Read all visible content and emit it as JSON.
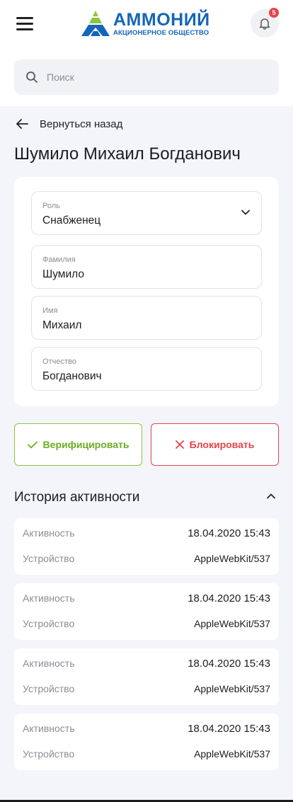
{
  "header": {
    "logo_name": "АММОНИЙ",
    "logo_subtitle": "АКЦИОНЕРНОЕ ОБЩЕСТВО",
    "notification_count": "5",
    "brand_color": "#1565b8"
  },
  "search": {
    "placeholder": "Поиск"
  },
  "back_link": {
    "label": "Вернуться назад"
  },
  "page_title": "Шумило Михаил Богданович",
  "form": {
    "role": {
      "label": "Роль",
      "value": "Снабженец"
    },
    "last_name": {
      "label": "Фамилия",
      "value": "Шумило"
    },
    "first_name": {
      "label": "Имя",
      "value": "Михаил"
    },
    "middle_name": {
      "label": "Отчество",
      "value": "Богданович"
    }
  },
  "actions": {
    "verify_label": "Верифицировать",
    "block_label": "Блокировать",
    "verify_color": "#6aae23",
    "block_color": "#e8424a"
  },
  "history": {
    "title": "История активности",
    "items": [
      {
        "activity_label": "Активность",
        "activity_value": "18.04.2020 15:43",
        "device_label": "Устройство",
        "device_value": "AppleWebKit/537"
      },
      {
        "activity_label": "Активность",
        "activity_value": "18.04.2020 15:43",
        "device_label": "Устройство",
        "device_value": "AppleWebKit/537"
      },
      {
        "activity_label": "Активность",
        "activity_value": "18.04.2020 15:43",
        "device_label": "Устройство",
        "device_value": "AppleWebKit/537"
      },
      {
        "activity_label": "Активность",
        "activity_value": "18.04.2020 15:43",
        "device_label": "Устройство",
        "device_value": "AppleWebKit/537"
      }
    ]
  },
  "icons": [
    "hamburger-menu-icon",
    "logo-mark-icon",
    "bell-icon",
    "search-icon",
    "arrow-left-icon",
    "chevron-down-icon",
    "check-icon",
    "close-icon",
    "chevron-up-icon"
  ]
}
